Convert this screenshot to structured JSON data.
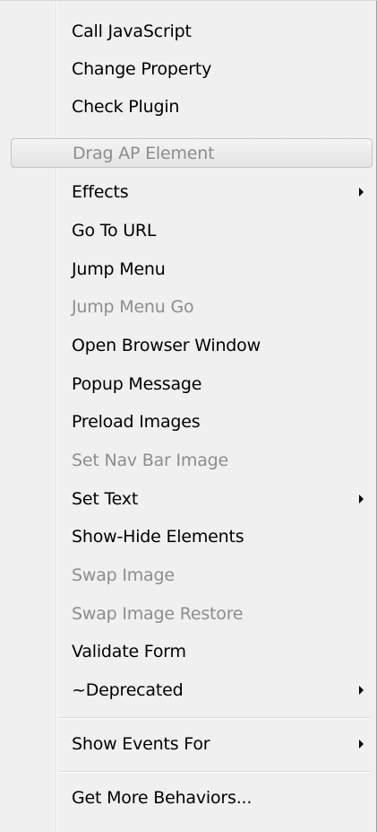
{
  "menu": {
    "items": [
      {
        "label": "Call JavaScript",
        "disabled": false,
        "submenu": false
      },
      {
        "label": "Change Property",
        "disabled": false,
        "submenu": false
      },
      {
        "label": "Check Plugin",
        "disabled": false,
        "submenu": false
      },
      {
        "label": "Drag AP Element",
        "disabled": true,
        "submenu": false,
        "highlighted": true
      },
      {
        "label": "Effects",
        "disabled": false,
        "submenu": true
      },
      {
        "label": "Go To URL",
        "disabled": false,
        "submenu": false
      },
      {
        "label": "Jump Menu",
        "disabled": false,
        "submenu": false
      },
      {
        "label": "Jump Menu Go",
        "disabled": true,
        "submenu": false
      },
      {
        "label": "Open Browser Window",
        "disabled": false,
        "submenu": false
      },
      {
        "label": "Popup Message",
        "disabled": false,
        "submenu": false
      },
      {
        "label": "Preload Images",
        "disabled": false,
        "submenu": false
      },
      {
        "label": "Set Nav Bar Image",
        "disabled": true,
        "submenu": false
      },
      {
        "label": "Set Text",
        "disabled": false,
        "submenu": true
      },
      {
        "label": "Show-Hide Elements",
        "disabled": false,
        "submenu": false
      },
      {
        "label": "Swap Image",
        "disabled": true,
        "submenu": false
      },
      {
        "label": "Swap Image Restore",
        "disabled": true,
        "submenu": false
      },
      {
        "label": "Validate Form",
        "disabled": false,
        "submenu": false
      },
      {
        "label": "~Deprecated",
        "disabled": false,
        "submenu": true
      },
      {
        "label": "Show Events For",
        "disabled": false,
        "submenu": true
      },
      {
        "label": "Get More Behaviors...",
        "disabled": false,
        "submenu": false
      }
    ]
  }
}
